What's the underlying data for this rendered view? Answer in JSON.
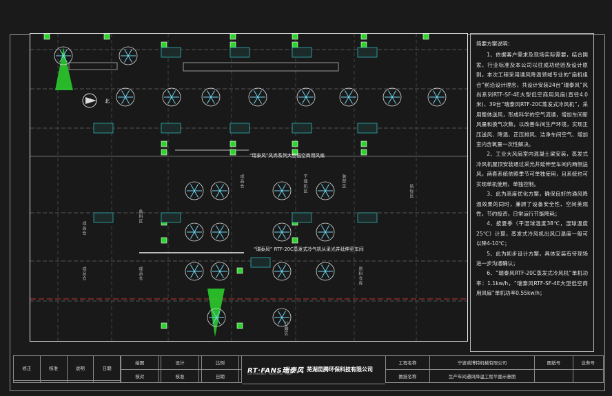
{
  "plan": {
    "north_label": "北",
    "callout_fan": "“瑞泰风”风尚系列大型低空商用风扇",
    "callout_cooler": "“瑞泰风” RTF-20C蒸发式冷气机从采光井延伸至车间",
    "unit_label": "采光井",
    "area_labels": [
      "成品仓",
      "成品仓",
      "成品仓",
      "备料区",
      "成品仓",
      "原料仓库",
      "打磨区",
      "贴标区",
      "干燥机区",
      "装配区"
    ]
  },
  "notes": {
    "title": "简要方案说明：",
    "paragraphs": [
      "1、依据客户需求及现场实际需要，结合国家、行业标准及本公司以往成功经验及设计原则，本次工程采用通风降温领域专业的“扇机组合”前沿设计理念，共设计安装24台“瑞泰风”风尚系列RTF-SF-4E大型低空商用风扇(直径4.0米)、39台“瑞泰风RTF-20C蒸发式冷风机”，采用整体送风，形成科学的空气流通，增加车间新风量和换气次数，以改善车间生产环境，实现正压送风、降温、正压排风、洁净车间空气、增加室内含氧量一次性解决。",
      "2、工业大风扇室内混凝土梁安装，蒸发式冷风机屋顶安装通过采光井延伸至车间内两侧送风，两套系统依照季节可单独使用，且系统也可实现单机使用、单独控制。",
      "3、此为高度优化方案，确保良好的通风降温效果的同时，兼顾了设备安全性、空间美观性，节约投资，日常运行节能降耗；",
      "4、按夏季（干湿球温度38℃，湿球温度25℃）计算，蒸发式冷风机出风口温度一般可以降4-10℃；",
      "5、此为初步设计方案，具体安装有待现场进一步沟通确认；",
      "6、“瑞泰风RTF-20C蒸发式冷风机”单机功率：1.1kw/h，“瑞泰风RTF-SF-4E大型低空商用风扇”单机功率0.55kw/h；"
    ]
  },
  "title_block": {
    "left": [
      "修正",
      "核准",
      "说明",
      "日期"
    ],
    "mid_row1": [
      "绘图",
      "",
      "设计",
      "",
      "比例",
      ""
    ],
    "mid_row2": [
      "核对",
      "",
      "核准",
      "",
      "日期",
      ""
    ],
    "logo_text": "RT·FANS瑞泰风",
    "logo_sub": "CUSTOMIZABLE · INDUSTRIAL · FANS",
    "company": "芜湖昆腾环保科技有限公司",
    "right_row1": [
      "工程名称",
      "宁波诺博特机械有限公司",
      "图纸号",
      "业务号"
    ],
    "right_row2": [
      "图纸名称",
      "生产车间通风降温工程平面示意图",
      "",
      ""
    ]
  },
  "colors": {
    "accent_green": "#2dd52d",
    "unit_cyan": "#2fb5b5",
    "wall_red": "#c83232",
    "background": "#1a1a1a"
  }
}
